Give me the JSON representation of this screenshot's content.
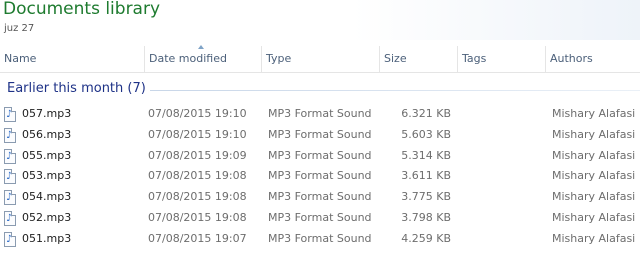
{
  "library": {
    "title": "Documents library",
    "subtitle": "juz 27"
  },
  "columns": {
    "name": "Name",
    "date_modified": "Date modified",
    "type": "Type",
    "size": "Size",
    "tags": "Tags",
    "authors": "Authors"
  },
  "group": {
    "label": "Earlier this month (7)"
  },
  "file_icon": "music-file-icon",
  "files": [
    {
      "name": "057.mp3",
      "date": "07/08/2015 19:10",
      "type": "MP3 Format Sound",
      "size": "6.321 KB",
      "tags": "",
      "authors": "Mishary Alafasi"
    },
    {
      "name": "056.mp3",
      "date": "07/08/2015 19:10",
      "type": "MP3 Format Sound",
      "size": "5.603 KB",
      "tags": "",
      "authors": "Mishary Alafasi"
    },
    {
      "name": "055.mp3",
      "date": "07/08/2015 19:09",
      "type": "MP3 Format Sound",
      "size": "5.314 KB",
      "tags": "",
      "authors": "Mishary Alafasi"
    },
    {
      "name": "053.mp3",
      "date": "07/08/2015 19:08",
      "type": "MP3 Format Sound",
      "size": "3.611 KB",
      "tags": "",
      "authors": "Mishary Alafasi"
    },
    {
      "name": "054.mp3",
      "date": "07/08/2015 19:08",
      "type": "MP3 Format Sound",
      "size": "3.775 KB",
      "tags": "",
      "authors": "Mishary Alafasi"
    },
    {
      "name": "052.mp3",
      "date": "07/08/2015 19:08",
      "type": "MP3 Format Sound",
      "size": "3.798 KB",
      "tags": "",
      "authors": "Mishary Alafasi"
    },
    {
      "name": "051.mp3",
      "date": "07/08/2015 19:07",
      "type": "MP3 Format Sound",
      "size": "4.259 KB",
      "tags": "",
      "authors": "Mishary Alafasi"
    }
  ]
}
